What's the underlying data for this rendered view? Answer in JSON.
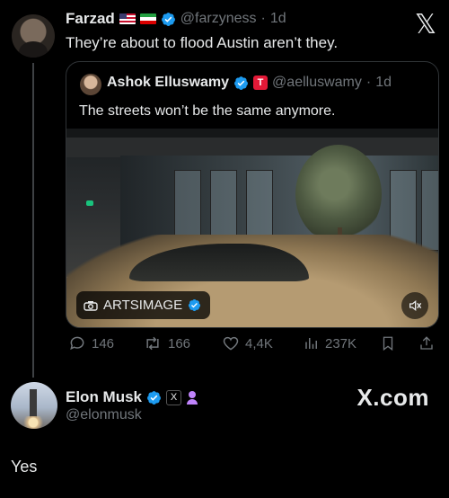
{
  "post": {
    "author_name": "Farzad",
    "author_handle": "@farzyness",
    "time": "1d",
    "text": "They’re about to flood Austin aren’t they."
  },
  "quoted": {
    "author_name": "Ashok Elluswamy",
    "author_handle": "@aelluswamy",
    "time": "1d",
    "text": "The streets won’t be the same anymore.",
    "media_credit": "ARTSIMAGE"
  },
  "actions": {
    "replies": "146",
    "reposts": "166",
    "likes": "4,4K",
    "views": "237K"
  },
  "reply": {
    "author_name": "Elon Musk",
    "author_handle": "@elonmusk",
    "text": "Yes"
  },
  "watermark": "X.com",
  "icons": [
    "x-logo-icon",
    "verified-icon",
    "us-flag-icon",
    "iran-flag-icon",
    "tesla-icon",
    "reply-icon",
    "repost-icon",
    "like-icon",
    "views-icon",
    "bookmark-icon",
    "share-icon",
    "mute-icon",
    "camera-icon",
    "person-icon"
  ],
  "colors": {
    "background": "#000000",
    "text": "#e7e9ea",
    "muted": "#71767b",
    "verified": "#1d9bf0",
    "tesla": "#e31937"
  }
}
